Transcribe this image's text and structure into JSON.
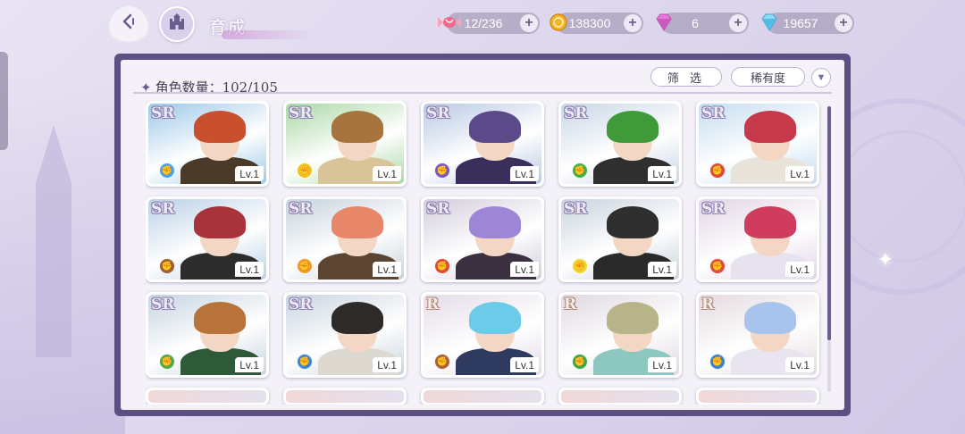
{
  "header": {
    "title": "育成",
    "back_icon": "back-arrow-icon",
    "home_icon": "castle-home-icon"
  },
  "resources": [
    {
      "name": "candy",
      "icon": "candy-icon",
      "value": "12/236"
    },
    {
      "name": "gold-coin",
      "icon": "coin-icon",
      "value": "138300"
    },
    {
      "name": "pink-gem",
      "icon": "pink-diamond-icon",
      "value": "6"
    },
    {
      "name": "blue-gem",
      "icon": "blue-diamond-icon",
      "value": "19657"
    }
  ],
  "panel": {
    "count_label": "角色数量：102/105",
    "filter_label": "筛 选",
    "rarity_label": "稀有度",
    "sort_icon": "triangle-down-icon"
  },
  "cards": [
    {
      "rarity": "SR",
      "level": "Lv.1",
      "attr_color": "#4aa3e8",
      "hair": "#c8502f",
      "outfit": "#4a3a2a",
      "sky": "#9cc8e8"
    },
    {
      "rarity": "SR",
      "level": "Lv.1",
      "attr_color": "#f0c21c",
      "hair": "#a8743e",
      "outfit": "#d9c49a",
      "sky": "#a9d8a4"
    },
    {
      "rarity": "SR",
      "level": "Lv.1",
      "attr_color": "#7a57c7",
      "hair": "#5a4a8a",
      "outfit": "#3a2f5a",
      "sky": "#b8c8e4"
    },
    {
      "rarity": "SR",
      "level": "Lv.1",
      "attr_color": "#42b04a",
      "hair": "#3f9a3a",
      "outfit": "#2f2f2f",
      "sky": "#c8d6e6"
    },
    {
      "rarity": "SR",
      "level": "Lv.1",
      "attr_color": "#e2483c",
      "hair": "#c7384a",
      "outfit": "#e8e4dc",
      "sky": "#c4dcf0"
    },
    {
      "rarity": "SR",
      "level": "Lv.1",
      "attr_color": "#9a5f32",
      "hair": "#a8333a",
      "outfit": "#2c2c2c",
      "sky": "#b9d0e6"
    },
    {
      "rarity": "SR",
      "level": "Lv.1",
      "attr_color": "#f0982a",
      "hair": "#e8866a",
      "outfit": "#5b4432",
      "sky": "#c6d2dc"
    },
    {
      "rarity": "SR",
      "level": "Lv.1",
      "attr_color": "#e04a3a",
      "hair": "#9e86d6",
      "outfit": "#3a3040",
      "sky": "#d2ccdc"
    },
    {
      "rarity": "SR",
      "level": "Lv.1",
      "attr_color": "#f0d430",
      "hair": "#2e2e2e",
      "outfit": "#2a2a2a",
      "sky": "#c8d2de"
    },
    {
      "rarity": "SR",
      "level": "Lv.1",
      "attr_color": "#e04a3a",
      "hair": "#d03c5e",
      "outfit": "#e6e2ee",
      "sky": "#e2d4e6"
    },
    {
      "rarity": "SR",
      "level": "Lv.1",
      "attr_color": "#4fa84a",
      "hair": "#b8733a",
      "outfit": "#2f5a3a",
      "sky": "#c6d4e0"
    },
    {
      "rarity": "SR",
      "level": "Lv.1",
      "attr_color": "#3a86d8",
      "hair": "#2e2a28",
      "outfit": "#ddd8d0",
      "sky": "#c8d4e0"
    },
    {
      "rarity": "R",
      "level": "Lv.1",
      "attr_color": "#a8623a",
      "hair": "#6ccbe8",
      "outfit": "#2e3a60",
      "sky": "#e4dce8"
    },
    {
      "rarity": "R",
      "level": "Lv.1",
      "attr_color": "#3aa84a",
      "hair": "#b8b48a",
      "outfit": "#8cc8c0",
      "sky": "#e0d8e0"
    },
    {
      "rarity": "R",
      "level": "Lv.1",
      "attr_color": "#3a82d0",
      "hair": "#a8c4ec",
      "outfit": "#e8e4f0",
      "sky": "#e4dae0"
    }
  ]
}
